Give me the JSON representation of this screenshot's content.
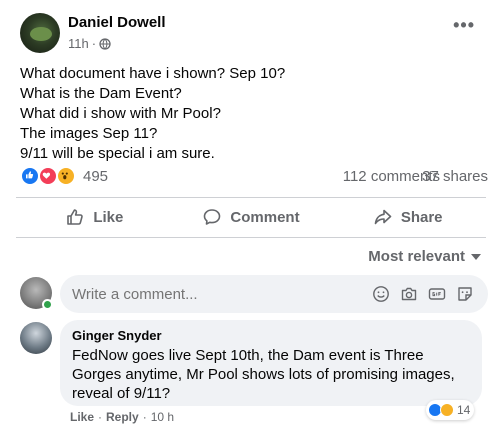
{
  "post": {
    "author": "Daniel Dowell",
    "time": "11h",
    "separator": "·",
    "text_lines": [
      "What document have i shown? Sep 10?",
      "What is the Dam Event?",
      "What did i show with Mr Pool?",
      "The images Sep 11?",
      "9/11 will be special i am sure."
    ],
    "reactions_count": "495",
    "comments_count": "112 comments",
    "shares_count": "37 shares",
    "reaction_icons": [
      "like-icon",
      "love-icon",
      "wow-icon"
    ]
  },
  "actions": {
    "like": "Like",
    "comment": "Comment",
    "share": "Share"
  },
  "sort": {
    "label": "Most relevant"
  },
  "composer": {
    "placeholder": "Write a comment..."
  },
  "comment": {
    "author": "Ginger Snyder",
    "text": "FedNow goes live Sept 10th, the Dam event is Three Gorges anytime, Mr Pool shows lots of promising images, reveal of 9/11?",
    "reaction_count": "14",
    "like": "Like",
    "reply": "Reply",
    "time": "10 h",
    "dot": "·"
  },
  "colors": {
    "like_blue": "#1877f2",
    "love_red": "#f33e58",
    "wow_yellow": "#f7b125",
    "secondary_text": "#65676b",
    "bubble_bg": "#f0f2f5",
    "online_green": "#31a24c"
  }
}
